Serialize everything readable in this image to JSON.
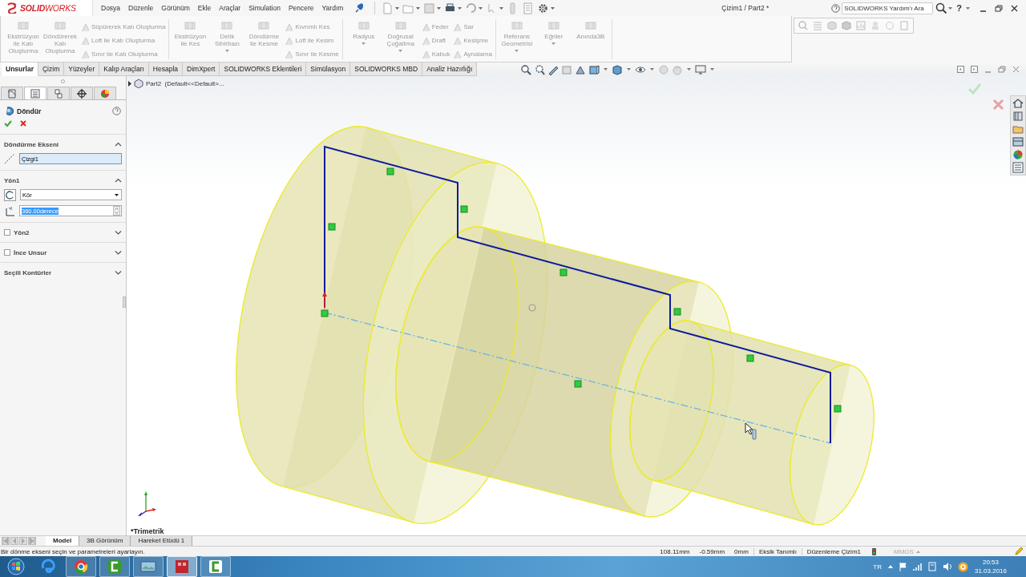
{
  "title_bar": {
    "logo": "**SOLID**WORKS",
    "menu": [
      "Dosya",
      "Düzenle",
      "Görünüm",
      "Ekle",
      "Araçlar",
      "Simulation",
      "Pencere",
      "Yardım"
    ],
    "document_title": "Çizim1 / Part2 *",
    "help_search": {
      "placeholder": "SOLIDWORKS Yardım'ı Ara"
    },
    "help_button": "?"
  },
  "ribbon": {
    "groups": [
      {
        "items": [
          {
            "kind": "large",
            "label": "Ekstrüzyon ile Katı Oluşturma",
            "disabled": true,
            "dropdown": false
          },
          {
            "kind": "large",
            "label": "Döndürerek Katı Oluşturma",
            "disabled": true,
            "dropdown": false
          },
          {
            "kind": "small",
            "label": "Süpürerek Katı Oluşturma",
            "disabled": true,
            "dropdown": false
          },
          {
            "kind": "small",
            "label": "Loft ile Katı Oluşturma",
            "disabled": true,
            "dropdown": false
          },
          {
            "kind": "small",
            "label": "Sınır ile Katı Oluşturma",
            "disabled": true,
            "dropdown": false
          }
        ]
      },
      {
        "items": [
          {
            "kind": "large",
            "label": "Ekstrüzyon ile Kes",
            "disabled": true,
            "dropdown": false
          },
          {
            "kind": "large",
            "label": "Delik Sihirbazı",
            "disabled": true,
            "dropdown": true
          },
          {
            "kind": "large",
            "label": "Döndürme ile Kesme",
            "disabled": true,
            "dropdown": false
          },
          {
            "kind": "small",
            "label": "Kıvrımlı Kes",
            "disabled": true,
            "dropdown": false
          },
          {
            "kind": "small",
            "label": "Loft ile Kesim",
            "disabled": true,
            "dropdown": false
          },
          {
            "kind": "small",
            "label": "Sınır ile Kesme",
            "disabled": true,
            "dropdown": false
          }
        ]
      },
      {
        "items": [
          {
            "kind": "large",
            "label": "Radyus",
            "disabled": true,
            "dropdown": true
          },
          {
            "kind": "large",
            "label": "Doğrusal Çoğaltma",
            "disabled": true,
            "dropdown": true
          },
          {
            "kind": "small",
            "label": "Feder",
            "disabled": true,
            "dropdown": false
          },
          {
            "kind": "small",
            "label": "Draft",
            "disabled": true,
            "dropdown": false
          },
          {
            "kind": "small",
            "label": "Kabuk",
            "disabled": true,
            "dropdown": false
          },
          {
            "kind": "small",
            "label": "Sar",
            "disabled": true,
            "dropdown": false
          },
          {
            "kind": "small",
            "label": "Kesişme",
            "disabled": true,
            "dropdown": false
          },
          {
            "kind": "small",
            "label": "Aynalama",
            "disabled": true,
            "dropdown": false
          }
        ]
      },
      {
        "items": [
          {
            "kind": "large",
            "label": "Referans Geometrisi",
            "disabled": true,
            "dropdown": true
          },
          {
            "kind": "large",
            "label": "Eğriler",
            "disabled": true,
            "dropdown": true
          },
          {
            "kind": "large",
            "label": "Anında3B",
            "disabled": true,
            "dropdown": false
          }
        ]
      }
    ]
  },
  "tabs": [
    {
      "label": "Unsurlar",
      "selected": true
    },
    {
      "label": "Çizim",
      "selected": false
    },
    {
      "label": "Yüzeyler",
      "selected": false
    },
    {
      "label": "Kalıp Araçları",
      "selected": false
    },
    {
      "label": "Hesapla",
      "selected": false
    },
    {
      "label": "DimXpert",
      "selected": false
    },
    {
      "label": "SOLIDWORKS Eklentileri",
      "selected": false
    },
    {
      "label": "Simülasyon",
      "selected": false
    },
    {
      "label": "SOLIDWORKS MBD",
      "selected": false
    },
    {
      "label": "Analiz Hazırlığı",
      "selected": false
    }
  ],
  "panel_tabs": [
    {
      "kind": "feature-tree",
      "selected": false
    },
    {
      "kind": "property-manager",
      "selected": true
    },
    {
      "kind": "configuration",
      "selected": false
    },
    {
      "kind": "dimxpert",
      "selected": false
    },
    {
      "kind": "display",
      "selected": false
    }
  ],
  "property_manager": {
    "title": "Döndür",
    "sections": [
      {
        "title": "Döndürme Ekseni",
        "kind": "plain",
        "expanded": true,
        "fields": [
          {
            "kind": "selection",
            "value": "Çizgi1",
            "selected": false
          }
        ]
      },
      {
        "title": "Yön1",
        "kind": "plain",
        "expanded": true,
        "fields": [
          {
            "kind": "dropdown",
            "value": "Kör",
            "selected": false
          },
          {
            "kind": "spinner",
            "value": "360.00derece",
            "selected": true
          }
        ]
      },
      {
        "title": "Yön2",
        "kind": "checkable",
        "checked": false,
        "expanded": false
      },
      {
        "title": "İnce Unsur",
        "kind": "checkable",
        "checked": false,
        "expanded": false
      },
      {
        "title": "Seçili Kontürler",
        "kind": "plain",
        "expanded": false
      }
    ]
  },
  "viewport": {
    "breadcrumb": "Part2  (Default<<Default>...",
    "view_name": "*Trimetrik"
  },
  "bottom_tabs": [
    {
      "label": "Model",
      "selected": true
    },
    {
      "label": "3B Görünüm",
      "selected": false
    },
    {
      "label": "Hareket Etüdü 1",
      "selected": false
    }
  ],
  "status_bar": {
    "message": "Bir dönme ekseni seçin ve parametreleri ayarlayın.",
    "fields": [
      "108.11mm",
      "-0.59mm",
      "0mm",
      "Eksik Tanımlı",
      "Düzenleme Çizim1"
    ],
    "units": "MMGS"
  },
  "taskbar": {
    "apps": [
      {
        "kind": "ie",
        "selected": false
      },
      {
        "kind": "chrome",
        "selected": false
      },
      {
        "kind": "camtasia",
        "selected": false
      },
      {
        "kind": "explorer",
        "selected": false
      },
      {
        "kind": "solidworks",
        "selected": true
      },
      {
        "kind": "camtasia-light",
        "selected": false
      }
    ],
    "language": "TR",
    "time": "20:53",
    "date": "31.03.2016"
  }
}
